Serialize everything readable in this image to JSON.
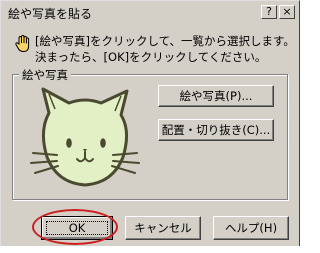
{
  "window": {
    "title": "絵や写真を貼る",
    "close_glyph": "×",
    "help_glyph": "?"
  },
  "instructions": {
    "line1": "[絵や写真]をクリックして、一覧から選択します。",
    "line2": "決まったら、[OK]をクリックしてください。"
  },
  "group": {
    "label": "絵や写真",
    "picture_button": "絵や写真(P)...",
    "layout_button": "配置・切り抜き(C)..."
  },
  "buttons": {
    "ok": "OK",
    "cancel": "キャンセル",
    "help": "ヘルプ(H)"
  },
  "colors": {
    "dialog_bg": "#d4d0c8",
    "cat_fill": "#e3f0c6",
    "highlight_ellipse": "#cc1f1f"
  }
}
